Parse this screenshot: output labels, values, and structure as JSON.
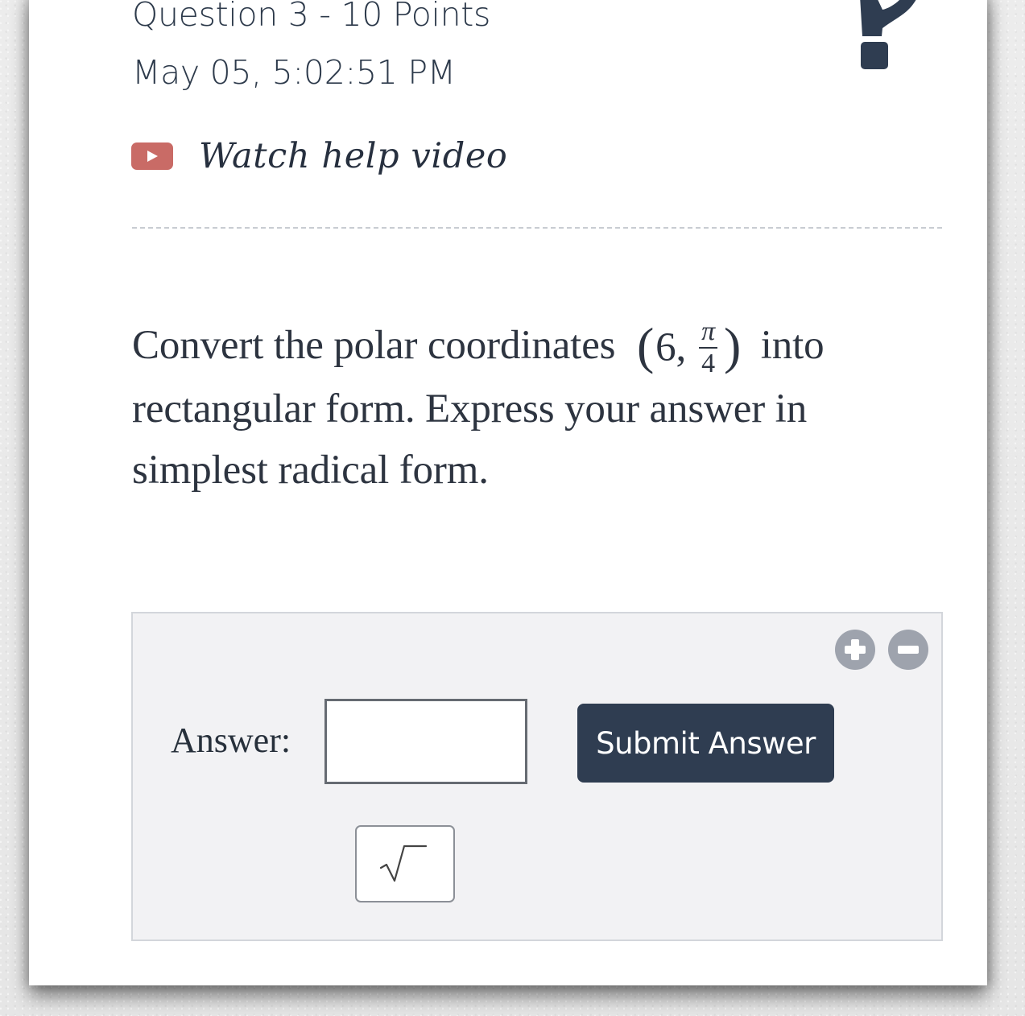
{
  "header": {
    "question_title": "Question 3 - 10 Points",
    "timestamp": "May 05, 5:02:51 PM",
    "help_video_label": "Watch help video",
    "help_icon": "question-mark-icon",
    "video_icon": "youtube-play-icon"
  },
  "question": {
    "before_math": "Convert the polar coordinates ",
    "math": {
      "left_paren": "(",
      "radius": "6,",
      "angle_numerator": "π",
      "angle_denominator": "4",
      "right_paren": ")"
    },
    "after_math": " into rectangular form. Express your answer in simplest radical form."
  },
  "answer_panel": {
    "answer_label": "Answer:",
    "answer_value": "",
    "submit_label": "Submit Answer",
    "zoom_in_icon": "plus-circle-icon",
    "zoom_out_icon": "minus-circle-icon",
    "sqrt_icon": "square-root-icon"
  },
  "colors": {
    "page_background": "#e9e9e9",
    "card_background": "#ffffff",
    "primary_text": "#2d3a4b",
    "video_icon": "#c96b66",
    "panel_background": "#f2f2f4",
    "submit_button": "#2f3d51",
    "control_icon": "#9ea3ad"
  }
}
